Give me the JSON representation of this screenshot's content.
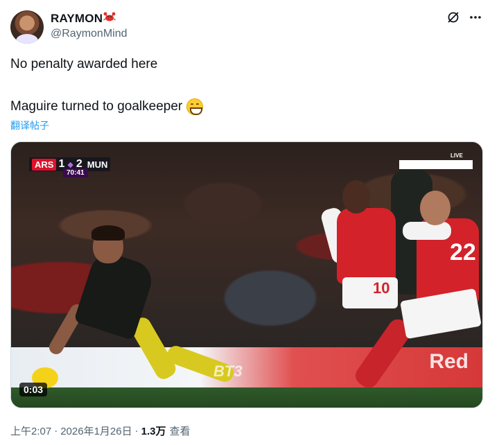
{
  "author": {
    "display_name": "RAYMON",
    "name_emoji": "crab",
    "handle": "@RaymonMind"
  },
  "tweet": {
    "line1": "No penalty awarded here",
    "line2": "Maguire turned to goalkeeper",
    "line2_emoji": "grinning-face",
    "translate_label": "翻译帖子"
  },
  "media": {
    "scorebug": {
      "home": "ARS",
      "home_score": "1",
      "away_score": "2",
      "away": "MUN",
      "clock": "70:41"
    },
    "live_label": "LIVE",
    "watermark": "BT3",
    "adboard_text": "Red",
    "home_player_number": "10",
    "away_player_number": "22",
    "duration": "0:03"
  },
  "meta": {
    "time": "上午2:07",
    "date": "2026年1月26日",
    "views_count": "1.3万",
    "views_label": "查看"
  },
  "colors": {
    "text": "#0f1419",
    "secondary": "#536471",
    "link": "#1d9bf0",
    "arsenal_red": "#d3222a"
  }
}
